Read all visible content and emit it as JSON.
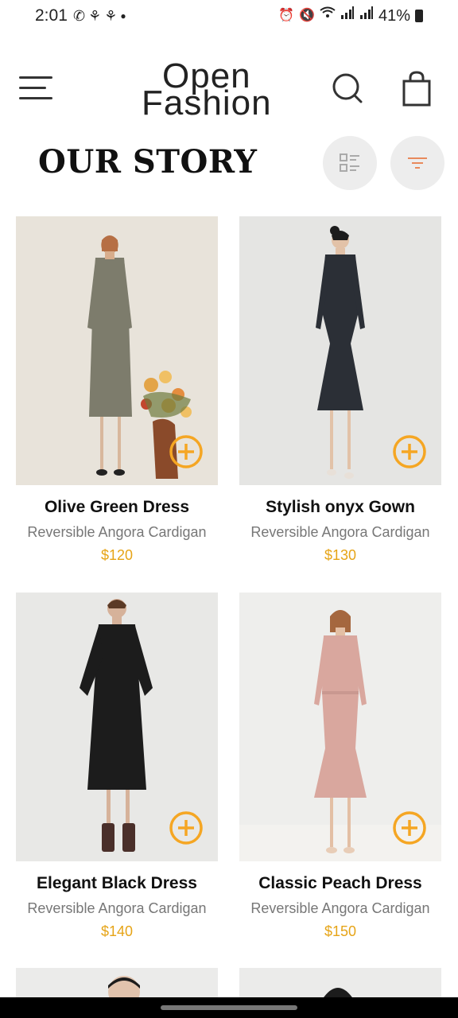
{
  "status": {
    "time": "2:01",
    "left_icons": [
      "whatsapp-icon",
      "snapchat-icon",
      "snapchat-icon",
      "dot-icon"
    ],
    "right_icons": [
      "alarm-icon",
      "mute-icon",
      "wifi-icon",
      "signal-icon",
      "signal-icon"
    ],
    "battery": "41%"
  },
  "header": {
    "logo_line1": "Open",
    "logo_line2": "Fashion",
    "menu_icon": "menu-icon",
    "search_icon": "search-icon",
    "bag_icon": "shopping-bag-icon"
  },
  "page": {
    "title": "OUR STORY",
    "view_toggle_icon": "list-view-icon",
    "filter_icon": "filter-icon"
  },
  "colors": {
    "accent": "#f5a623",
    "price": "#e6a417",
    "button_bg": "#ededed",
    "filter_icon": "#e88a5c"
  },
  "products": [
    {
      "name": "Olive Green Dress",
      "desc": "Reversible Angora Cardigan",
      "price": "$120",
      "dress_color": "#7d7c6c",
      "bg": "#e9e4dc"
    },
    {
      "name": "Stylish onyx Gown",
      "desc": "Reversible Angora Cardigan",
      "price": "$130",
      "dress_color": "#2b2f36",
      "bg": "#e6e6e4"
    },
    {
      "name": "Elegant Black Dress",
      "desc": "Reversible Angora Cardigan",
      "price": "$140",
      "dress_color": "#1c1c1c",
      "bg": "#e9e9e7"
    },
    {
      "name": "Classic Peach Dress",
      "desc": "Reversible Angora Cardigan",
      "price": "$150",
      "dress_color": "#d9a79e",
      "bg": "#eeeeec"
    }
  ]
}
